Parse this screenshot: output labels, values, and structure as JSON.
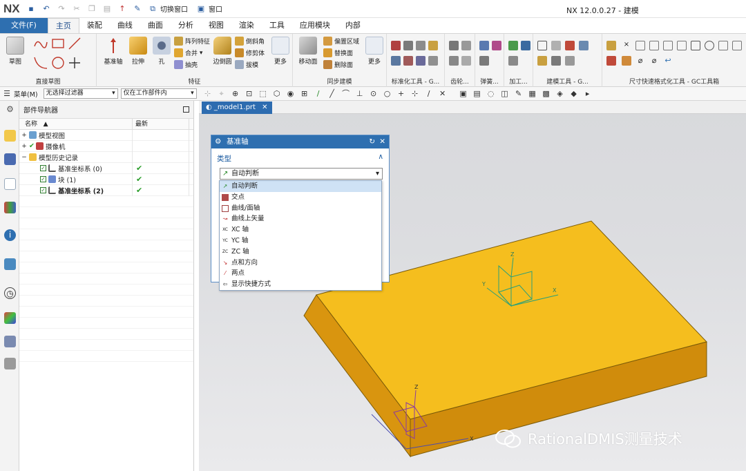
{
  "titlebar": {
    "logo": "NX",
    "quick_access": {
      "switch_window": "切换窗口",
      "window": "窗口"
    },
    "app_title": "NX 12.0.0.27 - 建模"
  },
  "menu": {
    "file": "文件(F)",
    "tabs": [
      "主页",
      "装配",
      "曲线",
      "曲面",
      "分析",
      "视图",
      "渲染",
      "工具",
      "应用模块",
      "内部"
    ],
    "active_tab": "主页"
  },
  "ribbon": {
    "groups": {
      "direct_sketch": "直接草图",
      "feature": "特征",
      "sync_modeling": "同步建模",
      "standard_tools": "标准化工具 - G...",
      "gear": "齿轮...",
      "spring": "弹簧...",
      "machining": "加工...",
      "modeling_tools": "建模工具 - G...",
      "dimension_tools": "尺寸快速格式化工具 - GC工具箱"
    },
    "buttons": {
      "sketch": "草图",
      "datum_axis": "基准轴",
      "extrude": "拉伸",
      "hole": "孔",
      "pattern_feature": "阵列特征",
      "unite": "合并",
      "shell": "抽壳",
      "edge_blend": "边倒圆",
      "chamfer": "倒斜角",
      "trim_body": "修剪体",
      "draft": "拔模",
      "more": "更多",
      "move_face": "移动面",
      "offset_region": "偏置区域",
      "replace_face": "替换面",
      "delete_face": "删除面",
      "more2": "更多"
    }
  },
  "selection_bar": {
    "menu": "菜单(M)",
    "filter": "无选择过滤器",
    "scope": "仅在工作部件内"
  },
  "navigator": {
    "title": "部件导航器",
    "col_name": "名称",
    "col_latest": "最新",
    "rows": [
      {
        "label": "模型视图",
        "latest": ""
      },
      {
        "label": "摄像机",
        "latest": ""
      },
      {
        "label": "模型历史记录",
        "latest": ""
      },
      {
        "label": "基准坐标系 (0)",
        "latest": "✔"
      },
      {
        "label": "块 (1)",
        "latest": "✔"
      },
      {
        "label": "基准坐标系 (2)",
        "latest": "✔"
      }
    ]
  },
  "viewport": {
    "tab_label": "_model1.prt"
  },
  "dialog": {
    "title": "基准轴",
    "section": "类型",
    "selected": "自动判断",
    "options": [
      "自动判断",
      "交点",
      "曲线/面轴",
      "曲线上矢量",
      "XC 轴",
      "YC 轴",
      "ZC 轴",
      "点和方向",
      "两点",
      "显示快捷方式"
    ]
  },
  "axes": {
    "x": "X",
    "y": "Y",
    "z": "Z"
  },
  "watermark": "RationalDMIS测量技术",
  "colors": {
    "accent": "#2e6fb0",
    "block_top": "#f5be1e",
    "block_side": "#d49310"
  }
}
